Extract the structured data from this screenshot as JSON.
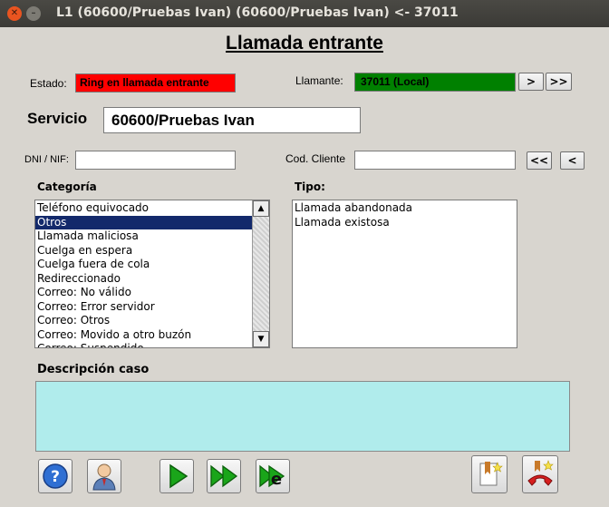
{
  "window": {
    "title": "L1 (60600/Pruebas Ivan) (60600/Pruebas Ivan) <- 37011"
  },
  "heading": "Llamada entrante",
  "estado": {
    "label": "Estado:",
    "value": "Ring en llamada entrante"
  },
  "llamante": {
    "label": "Llamante:",
    "value": "37011 (Local)",
    "next_label": ">",
    "last_label": ">>"
  },
  "servicio": {
    "label": "Servicio",
    "value": "60600/Pruebas Ivan"
  },
  "dni": {
    "label": "DNI / NIF:",
    "value": ""
  },
  "cod_cliente": {
    "label": "Cod. Cliente",
    "value": "",
    "first_label": "<<",
    "prev_label": "<"
  },
  "categoria": {
    "label": "Categoría",
    "items": [
      "Teléfono equivocado",
      "Otros",
      "Llamada maliciosa",
      "Cuelga en espera",
      "Cuelga fuera de cola",
      "Redireccionado",
      "Correo: No válido",
      "Correo: Error servidor",
      "Correo: Otros",
      "Correo: Movido a otro buzón",
      "Correo: Suspendido"
    ],
    "selected_index": 1
  },
  "tipo": {
    "label": "Tipo:",
    "items": [
      "Llamada abandonada",
      "Llamada existosa"
    ]
  },
  "descripcion": {
    "label": "Descripción caso",
    "value": ""
  },
  "colors": {
    "estado_bg": "#ff0000",
    "llamante_bg": "#008000",
    "descripcion_bg": "#b0ecec",
    "selection": "#13296b"
  }
}
